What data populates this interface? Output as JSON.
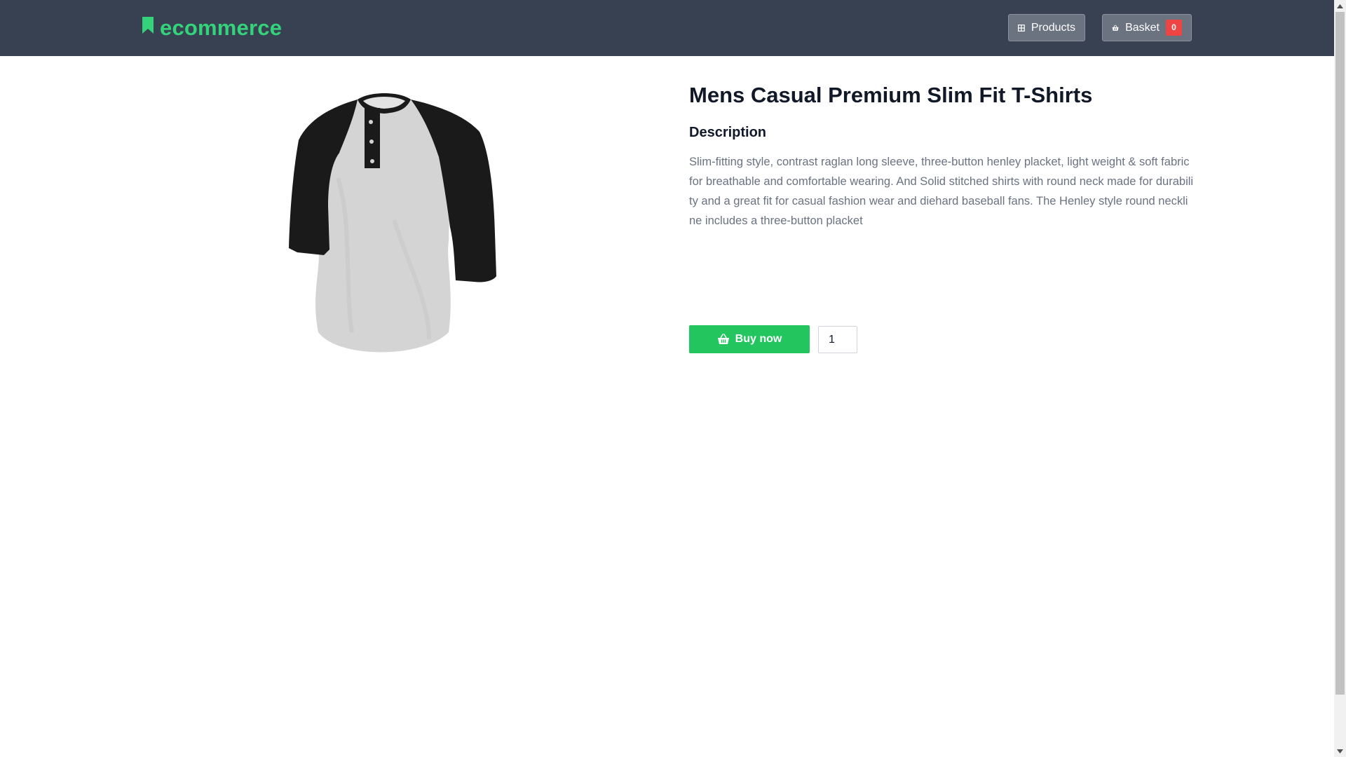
{
  "navbar": {
    "brand": "ecommerce",
    "products_label": "Products",
    "basket_label": "Basket",
    "basket_count": "0"
  },
  "product": {
    "title": "Mens Casual Premium Slim Fit T-Shirts",
    "description_heading": "Description",
    "description": "Slim-fitting style, contrast raglan long sleeve, three-button henley placket, light weight & soft fabric for breathable and comfortable wearing. And Solid stitched shirts with round neck made for durability and a great fit for casual fashion wear and diehard baseball fans. The Henley style round neckline includes a three-button placket",
    "image_icon": "shirt-image"
  },
  "purchase": {
    "buy_label": "Buy now",
    "quantity": "1"
  },
  "colors": {
    "navbar": "#374151",
    "brand": "#34d27a",
    "buy": "#22c55e",
    "badge": "#ef4444"
  }
}
